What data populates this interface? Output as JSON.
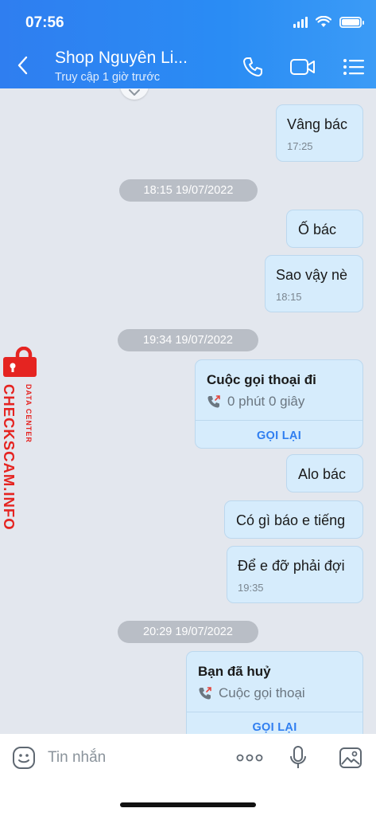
{
  "status_bar": {
    "time": "07:56"
  },
  "header": {
    "title": "Shop Nguyên Li...",
    "subtitle": "Truy cập 1 giờ trước"
  },
  "messages": [
    {
      "type": "sent",
      "text": "Vâng bác",
      "time": "17:25"
    },
    {
      "type": "date",
      "text": "18:15 19/07/2022"
    },
    {
      "type": "sent",
      "text": "Ố bác"
    },
    {
      "type": "sent",
      "text": "Sao vậy nè",
      "time": "18:15"
    },
    {
      "type": "date",
      "text": "19:34 19/07/2022"
    },
    {
      "type": "call",
      "title": "Cuộc gọi thoại đi",
      "detail": "0 phút 0 giây",
      "action": "GỌI LẠI"
    },
    {
      "type": "sent",
      "text": "Alo bác"
    },
    {
      "type": "sent",
      "text": "Có gì báo e tiếng"
    },
    {
      "type": "sent",
      "text": "Để e đỡ phải đợi",
      "time": "19:35"
    },
    {
      "type": "date",
      "text": "20:29 19/07/2022"
    },
    {
      "type": "call",
      "title": "Bạn đã huỷ",
      "detail": "Cuộc gọi thoại",
      "action": "GỌI LẠI"
    }
  ],
  "watermark": {
    "main": "CHECKSCAM.INFO",
    "sub": "DATA CENTER"
  },
  "input": {
    "placeholder": "Tin nhắn"
  },
  "colors": {
    "header": "#2f7ef0",
    "bubble": "#d6ecfc",
    "accent": "#2f7ef0",
    "watermark": "#e52421"
  }
}
